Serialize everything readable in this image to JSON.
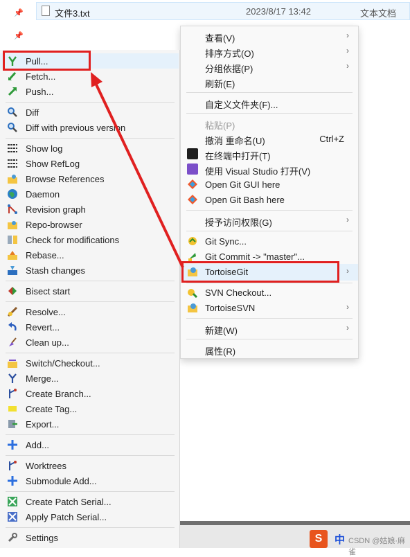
{
  "explorer": {
    "file": {
      "name": "文件3.txt",
      "modified": "2023/8/17 13:42",
      "type": "文本文档"
    }
  },
  "context_menu": {
    "items": [
      {
        "label": "查看(V)",
        "arrow": "›"
      },
      {
        "label": "排序方式(O)",
        "arrow": "›"
      },
      {
        "label": "分组依据(P)",
        "arrow": "›"
      },
      {
        "label": "刷新(E)"
      },
      {
        "label": "自定义文件夹(F)..."
      },
      {
        "label": "粘贴(P)"
      },
      {
        "label": "撤消 重命名(U)",
        "shortcut": "Ctrl+Z"
      },
      {
        "label": "在终端中打开(T)"
      },
      {
        "label": "使用 Visual Studio 打开(V)"
      },
      {
        "label": "Open Git GUI here"
      },
      {
        "label": "Open Git Bash here"
      },
      {
        "label": "授予访问权限(G)",
        "arrow": "›"
      },
      {
        "label": "Git Sync..."
      },
      {
        "label": "Git Commit -> \"master\"..."
      },
      {
        "label": "TortoiseGit",
        "arrow": "›"
      },
      {
        "label": "SVN Checkout..."
      },
      {
        "label": "TortoiseSVN",
        "arrow": "›"
      },
      {
        "label": "新建(W)",
        "arrow": "›"
      },
      {
        "label": "属性(R)"
      }
    ]
  },
  "tortoisegit_menu": {
    "items": [
      {
        "label": "Pull..."
      },
      {
        "label": "Fetch..."
      },
      {
        "label": "Push..."
      },
      {
        "label": "Diff"
      },
      {
        "label": "Diff with previous version"
      },
      {
        "label": "Show log"
      },
      {
        "label": "Show RefLog"
      },
      {
        "label": "Browse References"
      },
      {
        "label": "Daemon"
      },
      {
        "label": "Revision graph"
      },
      {
        "label": "Repo-browser"
      },
      {
        "label": "Check for modifications"
      },
      {
        "label": "Rebase..."
      },
      {
        "label": "Stash changes"
      },
      {
        "label": "Bisect start"
      },
      {
        "label": "Resolve..."
      },
      {
        "label": "Revert..."
      },
      {
        "label": "Clean up..."
      },
      {
        "label": "Switch/Checkout..."
      },
      {
        "label": "Merge..."
      },
      {
        "label": "Create Branch..."
      },
      {
        "label": "Create Tag..."
      },
      {
        "label": "Export..."
      },
      {
        "label": "Add..."
      },
      {
        "label": "Worktrees"
      },
      {
        "label": "Submodule Add..."
      },
      {
        "label": "Create Patch Serial..."
      },
      {
        "label": "Apply Patch Serial..."
      },
      {
        "label": "Settings"
      }
    ]
  },
  "taskbar": {
    "ime_logo": "S",
    "ime_lang": "中",
    "watermark": "CSDN @姑娘·麻雀"
  },
  "colors": {
    "annotation": "#e02020",
    "highlight": "#e5f1fb"
  }
}
